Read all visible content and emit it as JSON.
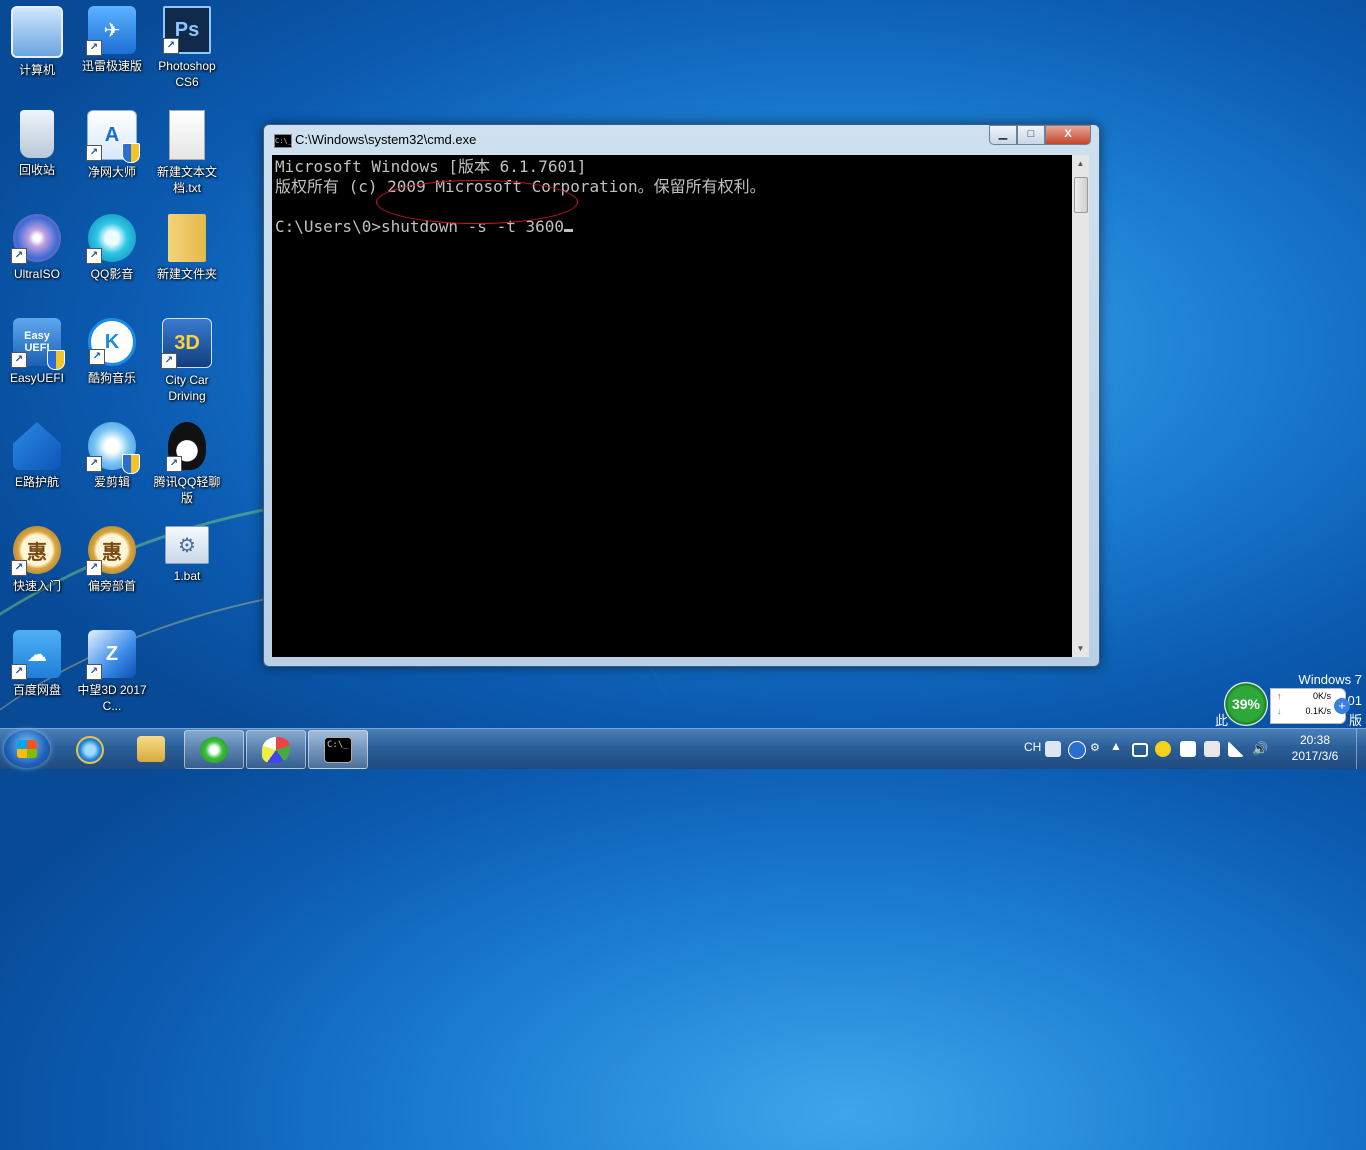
{
  "desktop": {
    "icons": [
      {
        "label": "计算机"
      },
      {
        "label": "迅雷极速版"
      },
      {
        "label": "Photoshop CS6",
        "glyph": "Ps"
      },
      {
        "label": "回收站"
      },
      {
        "label": "净网大师",
        "glyph": "A"
      },
      {
        "label": "新建文本文档.txt"
      },
      {
        "label": "UltraISO"
      },
      {
        "label": "QQ影音"
      },
      {
        "label": "新建文件夹"
      },
      {
        "label": "EasyUEFI",
        "glyph": "Easy UEFI"
      },
      {
        "label": "酷狗音乐",
        "glyph": "K"
      },
      {
        "label": "City Car Driving",
        "glyph": "3D"
      },
      {
        "label": "E路护航"
      },
      {
        "label": "爱剪辑"
      },
      {
        "label": "腾讯QQ轻聊版"
      },
      {
        "label": "快速入门",
        "glyph": "惠"
      },
      {
        "label": "偏旁部首",
        "glyph": "惠"
      },
      {
        "label": "1.bat"
      },
      {
        "label": "百度网盘"
      },
      {
        "label": "中望3D 2017 C..."
      }
    ]
  },
  "cmd_window": {
    "icon_text": "C:\\_",
    "title": "C:\\Windows\\system32\\cmd.exe",
    "minimize": "▁",
    "maximize": "□",
    "close": "X",
    "line1": "Microsoft Windows [版本 6.1.7601]",
    "line2": "版权所有 (c) 2009 Microsoft Corporation。保留所有权利。",
    "prompt": "C:\\Users\\0>",
    "command": "shutdown -s -t 3600"
  },
  "watermark": {
    "line1": "Windows 7",
    "line2": "01",
    "line3": "此",
    "line4": "版"
  },
  "net_meter": {
    "percent": "39%",
    "up": "0K/s",
    "down": "0.1K/s",
    "up_arrow": "↑",
    "down_arrow": "↓"
  },
  "taskbar": {
    "language": "CH",
    "time": "20:38",
    "date": "2017/3/6",
    "cmd_button_text": "C:\\_"
  }
}
